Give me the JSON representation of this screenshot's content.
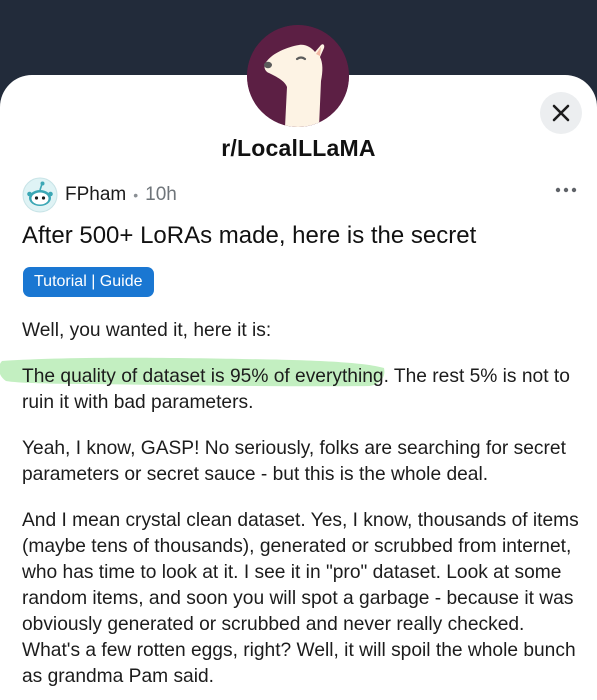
{
  "community": {
    "name": "r/LocalLLaMA",
    "avatar_icon": "llama-icon",
    "avatar_bg": "#5c1f44"
  },
  "header": {
    "close_icon": "close-icon"
  },
  "post": {
    "author": "FPham",
    "separator": "•",
    "time": "10h",
    "more_icon": "more-options-icon",
    "title": "After 500+ LoRAs made, here is the secret",
    "flair": "Tutorial | Guide",
    "flair_color": "#1a77d2",
    "highlight_color": "#b9ecb6",
    "paragraphs": {
      "p1": "Well, you wanted it, here it is:",
      "p2_highlighted": "The quality of dataset is 95% of everything",
      "p2_rest": ". The rest 5% is not to ruin it with bad parameters.",
      "p3": "Yeah, I know, GASP! No seriously, folks are searching for secret parameters or secret sauce - but this is the whole deal.",
      "p4": "And I mean crystal clean dataset. Yes, I know, thousands of items (maybe tens of thousands), generated or scrubbed from internet, who has time to look at it. I see it in \"pro\" dataset. Look at some random items, and soon you will spot a garbage - because it was obviously generated or scrubbed and never really checked. What's a few rotten eggs, right? Well, it will spoil the whole bunch as grandma Pam said."
    }
  }
}
